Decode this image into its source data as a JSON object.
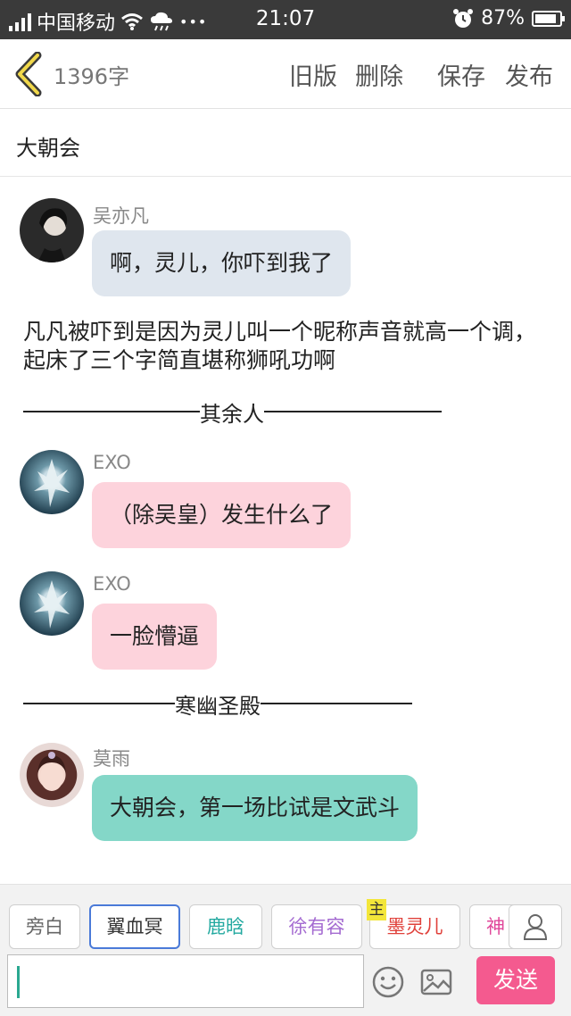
{
  "status_bar": {
    "carrier": "中国移动",
    "time": "21:07",
    "battery": "87%",
    "dots": "•••",
    "battery_level": 0.87
  },
  "toolbar": {
    "word_count": "1396字",
    "old_version": "旧版",
    "delete": "删除",
    "save": "保存",
    "publish": "发布"
  },
  "title": "大朝会",
  "messages": [
    {
      "speaker": "吴亦凡",
      "text": "啊，灵儿，你吓到我了",
      "bubble_color": "#dfe6ee"
    },
    {
      "speaker": "EXO",
      "text": "（除吴皇）发生什么了",
      "bubble_color": "#fdd3dc"
    },
    {
      "speaker": "EXO",
      "text": "一脸懵逼",
      "bubble_color": "#fdd3dc"
    },
    {
      "speaker": "莫雨",
      "text": "大朝会，第一场比试是文武斗",
      "bubble_color": "#84d7c8"
    }
  ],
  "narration": "凡凡被吓到是因为灵儿叫一个昵称声音就高一个调，起床了三个字简直堪称狮吼功啊",
  "dividers": [
    "其余人",
    "寒幽圣殿"
  ],
  "characters": [
    {
      "label": "旁白",
      "color": "#666666"
    },
    {
      "label": "翼血冥",
      "color": "#333333"
    },
    {
      "label": "鹿晗",
      "color": "#23a9a0"
    },
    {
      "label": "徐有容",
      "color": "#a46bd1"
    },
    {
      "label": "墨灵儿",
      "color": "#e0403a"
    },
    {
      "label": "神",
      "color": "#e0479a"
    }
  ],
  "main_badge": "主",
  "send_label": "发送",
  "icons": {
    "back": "chevron-left-icon",
    "wifi": "wifi-icon",
    "weather": "cloud-rain-icon",
    "alarm": "alarm-icon",
    "emoji": "emoji-icon",
    "image": "image-icon",
    "user": "user-icon"
  }
}
